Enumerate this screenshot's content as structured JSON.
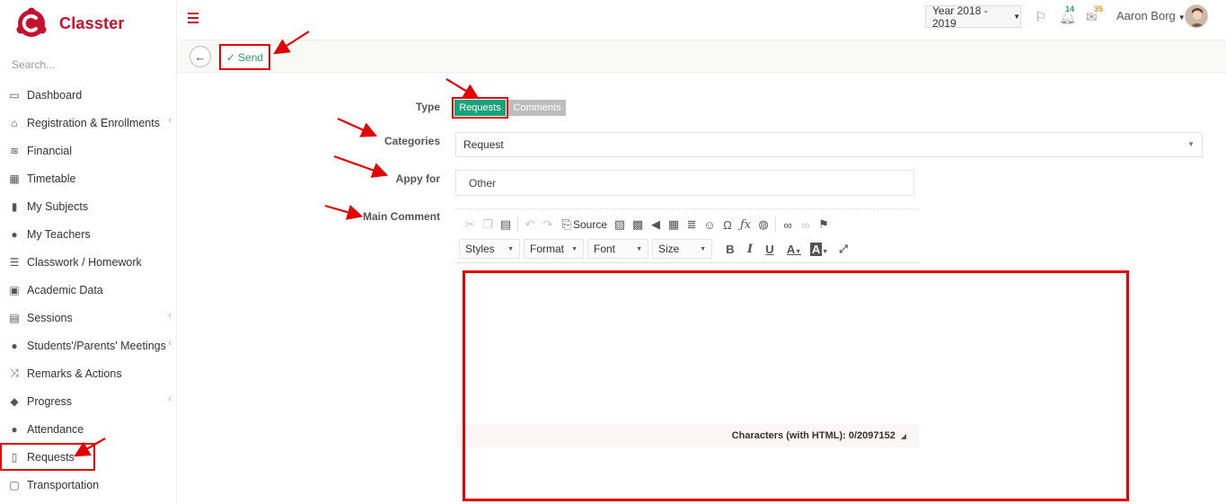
{
  "app": {
    "name": "Classter"
  },
  "search": {
    "placeholder": "Search..."
  },
  "sidebar": {
    "items": [
      {
        "label": "Dashboard",
        "icon": "laptop-icon",
        "glyph": "▭",
        "has_submenu": false
      },
      {
        "label": "Registration & Enrollments",
        "icon": "institution-icon",
        "glyph": "⌂",
        "has_submenu": true
      },
      {
        "label": "Financial",
        "icon": "coins-icon",
        "glyph": "≋",
        "has_submenu": false
      },
      {
        "label": "Timetable",
        "icon": "calendar-icon",
        "glyph": "▦",
        "has_submenu": false
      },
      {
        "label": "My Subjects",
        "icon": "book-icon",
        "glyph": "▮",
        "has_submenu": false
      },
      {
        "label": "My Teachers",
        "icon": "users-icon",
        "glyph": "●",
        "has_submenu": false
      },
      {
        "label": "Classwork / Homework",
        "icon": "list-icon",
        "glyph": "☰",
        "has_submenu": false
      },
      {
        "label": "Academic Data",
        "icon": "id-card-icon",
        "glyph": "▣",
        "has_submenu": false
      },
      {
        "label": "Sessions",
        "icon": "presentation-icon",
        "glyph": "▤",
        "has_submenu": true
      },
      {
        "label": "Students'/Parents' Meetings",
        "icon": "meeting-icon",
        "glyph": "●",
        "has_submenu": true
      },
      {
        "label": "Remarks & Actions",
        "icon": "shuffle-icon",
        "glyph": "⤨",
        "has_submenu": false
      },
      {
        "label": "Progress",
        "icon": "graduation-cap-icon",
        "glyph": "◆",
        "has_submenu": true
      },
      {
        "label": "Attendance",
        "icon": "user-check-icon",
        "glyph": "●",
        "has_submenu": false
      },
      {
        "label": "Requests",
        "icon": "file-icon",
        "glyph": "▯",
        "has_submenu": false
      },
      {
        "label": "Transportation",
        "icon": "bus-icon",
        "glyph": "▢",
        "has_submenu": false
      }
    ]
  },
  "topbar": {
    "year": "Year 2018 - 2019",
    "notifications_count": "14",
    "messages_count": "35",
    "user_name": "Aaron Borg"
  },
  "actions": {
    "send_label": "Send"
  },
  "form": {
    "type_label": "Type",
    "type_options": [
      "Requests",
      "Comments"
    ],
    "type_selected": "Requests",
    "categories_label": "Categories",
    "categories_value": "Request",
    "apply_for_label": "Appy for",
    "apply_for_value": "Other",
    "main_comment_label": "Main Comment"
  },
  "editor": {
    "source_label": "Source",
    "styles_label": "Styles",
    "format_label": "Format",
    "font_label": "Font",
    "size_label": "Size",
    "bold": "B",
    "italic": "I",
    "underline": "U",
    "text_color": "A",
    "bg_color": "A",
    "char_count": "Characters (with HTML): 0/2097152"
  },
  "colors": {
    "brand": "#c8102e",
    "accent_green": "#1aa37a",
    "annotation_red": "#e30000",
    "badge_green": "#2a9d6a",
    "badge_orange": "#f0932b"
  }
}
